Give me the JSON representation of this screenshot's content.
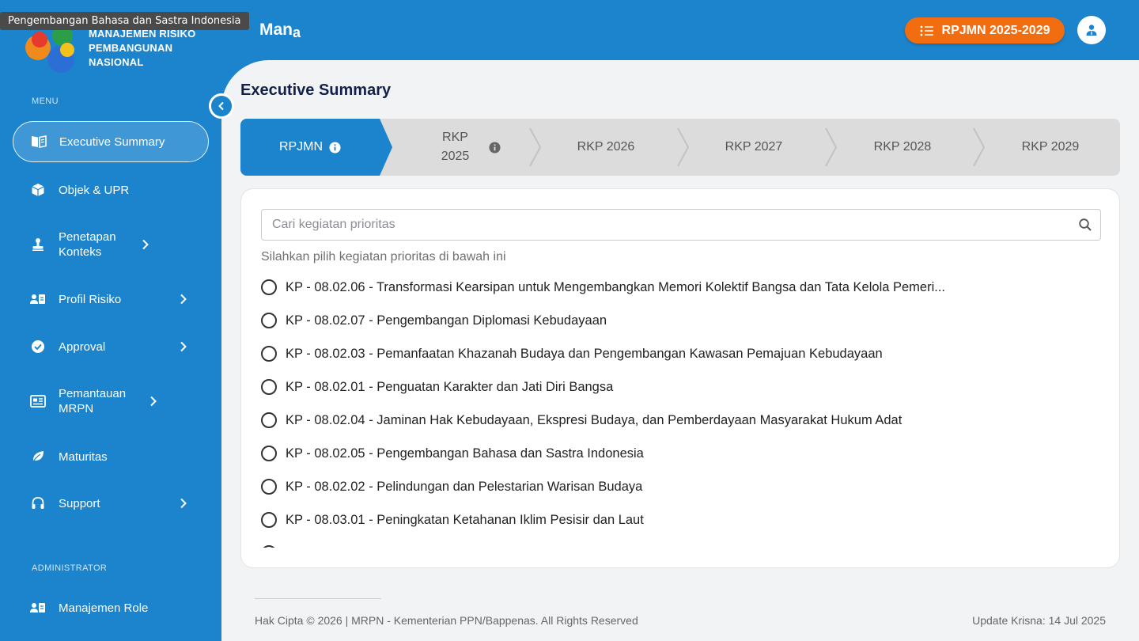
{
  "tooltip": "Pengembangan Bahasa dan Sastra Indonesia",
  "brand": {
    "line1": "MANAJEMEN RISIKO",
    "line2": "PEMBANGUNAN",
    "line3": "NASIONAL"
  },
  "header": {
    "title_main": "Man",
    "title_sub": "a",
    "period_button": "RPJMN 2025-2029"
  },
  "sidebar": {
    "menu_label": "MENU",
    "admin_label": "ADMINISTRATOR",
    "items": [
      {
        "label": "Executive Summary",
        "icon": "book-open-icon",
        "active": true
      },
      {
        "label": "Objek & UPR",
        "icon": "cube-icon"
      },
      {
        "label": "Penetapan Konteks",
        "icon": "stamp-icon",
        "submenu": true
      },
      {
        "label": "Profil Risiko",
        "icon": "id-card-icon",
        "submenu": true
      },
      {
        "label": "Approval",
        "icon": "check-circle-icon",
        "submenu": true
      },
      {
        "label": "Pemantauan MRPN",
        "icon": "monitor-icon",
        "submenu": true
      },
      {
        "label": "Maturitas",
        "icon": "leaf-icon"
      },
      {
        "label": "Support",
        "icon": "headset-icon",
        "submenu": true
      }
    ],
    "admin_items": [
      {
        "label": "Manajemen Role",
        "icon": "users-role-icon"
      }
    ]
  },
  "main": {
    "page_title": "Executive Summary",
    "steps": [
      {
        "label": "RPJMN",
        "active": true,
        "info": true
      },
      {
        "label": "RKP 2025",
        "info": true
      },
      {
        "label": "RKP 2026"
      },
      {
        "label": "RKP 2027"
      },
      {
        "label": "RKP 2028"
      },
      {
        "label": "RKP 2029"
      }
    ],
    "search_placeholder": "Cari kegiatan prioritas",
    "hint": "Silahkan pilih kegiatan prioritas di bawah ini",
    "options": [
      "KP - 08.02.06 - Transformasi Kearsipan untuk Mengembangkan Memori Kolektif Bangsa dan Tata Kelola Pemeri...",
      "KP - 08.02.07 - Pengembangan Diplomasi Kebudayaan",
      "KP - 08.02.03 - Pemanfaatan Khazanah Budaya dan Pengembangan Kawasan Pemajuan Kebudayaan",
      "KP - 08.02.01 - Penguatan Karakter dan Jati Diri Bangsa",
      "KP - 08.02.04 - Jaminan Hak Kebudayaan, Ekspresi Budaya, dan Pemberdayaan Masyarakat Hukum Adat",
      "KP - 08.02.05 - Pengembangan Bahasa dan Sastra Indonesia",
      "KP - 08.02.02 - Pelindungan dan Pelestarian Warisan Budaya",
      "KP - 08.03.01 - Peningkatan Ketahanan Iklim Pesisir dan Laut",
      ""
    ]
  },
  "footer": {
    "copyright": "Hak Cipta © 2026 | MRPN - Kementerian PPN/Bappenas. All Rights Reserved",
    "update": "Update Krisna: 14 Jul 2025"
  },
  "colors": {
    "primary": "#1b84cd",
    "accent": "#f26d0f",
    "background": "#f2f3f5",
    "title": "#12204a"
  }
}
